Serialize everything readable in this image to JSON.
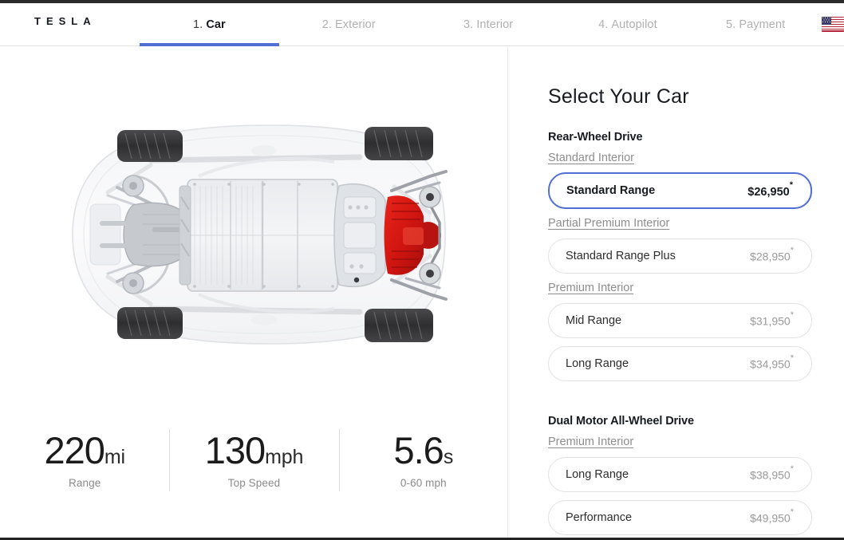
{
  "brand": "TESLA",
  "nav": {
    "tabs": [
      {
        "num": "1.",
        "label": "Car",
        "active": true
      },
      {
        "num": "2.",
        "label": "Exterior",
        "active": false
      },
      {
        "num": "3.",
        "label": "Interior",
        "active": false
      },
      {
        "num": "4.",
        "label": "Autopilot",
        "active": false
      },
      {
        "num": "5.",
        "label": "Payment",
        "active": false
      }
    ],
    "locale_icon": "us-flag-icon",
    "active_color": "#4f6fd6",
    "inactive_color": "#b0b0b0"
  },
  "stage": {
    "vehicle_view": "model-3-chassis-underbody",
    "specs": [
      {
        "value": "220",
        "unit": "mi",
        "label": "Range"
      },
      {
        "value": "130",
        "unit": "mph",
        "label": "Top Speed"
      },
      {
        "value": "5.6",
        "unit": "s",
        "label": "0-60 mph"
      }
    ]
  },
  "panel": {
    "title": "Select Your Car",
    "groups": [
      {
        "title": "Rear-Wheel Drive",
        "subgroups": [
          {
            "label": "Standard Interior",
            "options": [
              {
                "name": "Standard Range",
                "price": "$26,950",
                "asterisk": "*",
                "selected": true
              }
            ]
          },
          {
            "label": "Partial Premium Interior",
            "options": [
              {
                "name": "Standard Range Plus",
                "price": "$28,950",
                "asterisk": "*",
                "selected": false
              }
            ]
          },
          {
            "label": "Premium Interior",
            "options": [
              {
                "name": "Mid Range",
                "price": "$31,950",
                "asterisk": "*",
                "selected": false
              },
              {
                "name": "Long Range",
                "price": "$34,950",
                "asterisk": "*",
                "selected": false
              }
            ]
          }
        ]
      },
      {
        "title": "Dual Motor All-Wheel Drive",
        "subgroups": [
          {
            "label": "Premium Interior",
            "options": [
              {
                "name": "Long Range",
                "price": "$38,950",
                "asterisk": "*",
                "selected": false
              },
              {
                "name": "Performance",
                "price": "$49,950",
                "asterisk": "*",
                "selected": false
              }
            ]
          }
        ]
      }
    ],
    "selected_border_color": "#4f6fd6",
    "unselected_border_color": "#e2e2e2"
  }
}
